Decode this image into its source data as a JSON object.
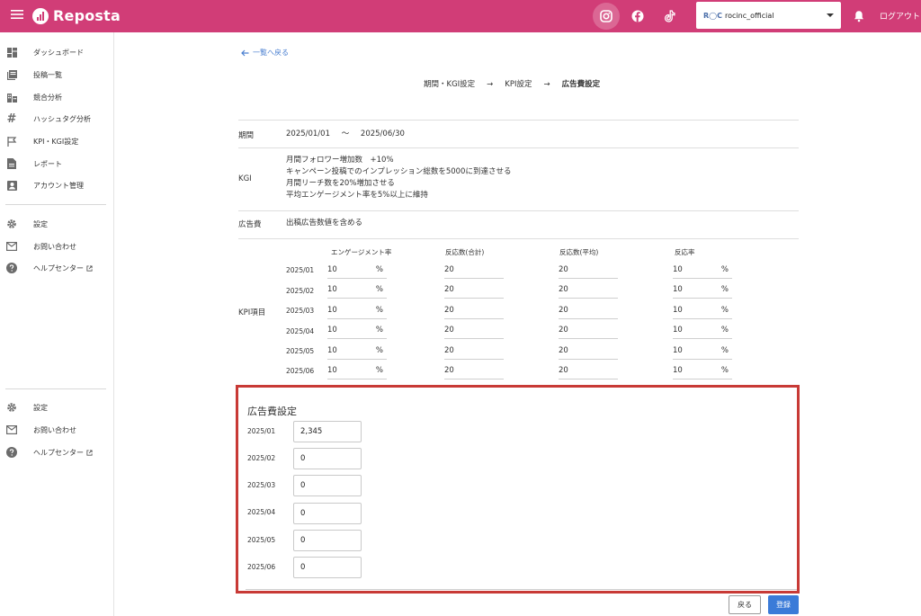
{
  "app": {
    "name": "Reposta"
  },
  "header": {
    "sns": [
      {
        "name": "instagram",
        "icon": "instagram-icon"
      },
      {
        "name": "facebook",
        "icon": "facebook-icon"
      },
      {
        "name": "tiktok",
        "icon": "tiktok-icon"
      }
    ],
    "account": {
      "logo_text": "R◯C",
      "name": "rocinc_official"
    },
    "logout_label": "ログアウト"
  },
  "sidebar": {
    "items": [
      {
        "label": "ダッシュボード",
        "icon": "dashboard-icon"
      },
      {
        "label": "投稿一覧",
        "icon": "post-list-icon"
      },
      {
        "label": "競合分析",
        "icon": "competitor-icon"
      },
      {
        "label": "ハッシュタグ分析",
        "icon": "hashtag-icon"
      },
      {
        "label": "KPI・KGI設定",
        "icon": "flag-icon"
      },
      {
        "label": "レポート",
        "icon": "report-icon"
      },
      {
        "label": "アカウント管理",
        "icon": "account-icon"
      }
    ],
    "support_top": [
      {
        "label": "設定",
        "icon": "gear-icon"
      },
      {
        "label": "お問い合わせ",
        "icon": "mail-icon"
      },
      {
        "label": "ヘルプセンター",
        "icon": "help-icon"
      }
    ],
    "support_bottom": [
      {
        "label": "設定",
        "icon": "gear-icon"
      },
      {
        "label": "お問い合わせ",
        "icon": "mail-icon"
      },
      {
        "label": "ヘルプセンター",
        "icon": "help-icon"
      }
    ]
  },
  "main": {
    "back_link": "一覧へ戻る",
    "steps": [
      "期間・KGI設定",
      "→",
      "KPI設定",
      "→",
      "広告費設定"
    ],
    "period": {
      "label": "期間",
      "start": "2025/01/01",
      "tilde": "～",
      "end": "2025/06/30"
    },
    "kgi": {
      "label": "KGI",
      "lines": [
        "月間フォロワー増加数　+10%",
        "キャンペーン投稿でのインプレッション総数を5000に到達させる",
        "月間リーチ数を20%増加させる",
        "平均エンゲージメント率を5%以上に維持"
      ]
    },
    "ad_cost": {
      "label": "広告費",
      "text": "出稿広告数値を含める"
    },
    "kpi": {
      "label": "KPI項目",
      "headers": [
        "エンゲージメント率",
        "反応数(合計)",
        "反応数(平均)",
        "反応率"
      ],
      "rows": [
        {
          "month": "2025/01",
          "engagement": "10",
          "total": "20",
          "avg": "20",
          "rate": "10"
        },
        {
          "month": "2025/02",
          "engagement": "10",
          "total": "20",
          "avg": "20",
          "rate": "10"
        },
        {
          "month": "2025/03",
          "engagement": "10",
          "total": "20",
          "avg": "20",
          "rate": "10"
        },
        {
          "month": "2025/04",
          "engagement": "10",
          "total": "20",
          "avg": "20",
          "rate": "10"
        },
        {
          "month": "2025/05",
          "engagement": "10",
          "total": "20",
          "avg": "20",
          "rate": "10"
        },
        {
          "month": "2025/06",
          "engagement": "10",
          "total": "20",
          "avg": "20",
          "rate": "10"
        }
      ],
      "percent": "%"
    },
    "ad_settings": {
      "title": "広告費設定",
      "rows": [
        {
          "month": "2025/01",
          "value": "2,345"
        },
        {
          "month": "2025/02",
          "value": "0"
        },
        {
          "month": "2025/03",
          "value": "0"
        },
        {
          "month": "2025/04",
          "value": "0"
        },
        {
          "month": "2025/05",
          "value": "0"
        },
        {
          "month": "2025/06",
          "value": "0"
        }
      ]
    },
    "buttons": {
      "back": "戻る",
      "submit": "登録"
    }
  },
  "colors": {
    "brand": "#d13d77",
    "primary": "#3b7bd8",
    "highlight": "#c83a36"
  }
}
